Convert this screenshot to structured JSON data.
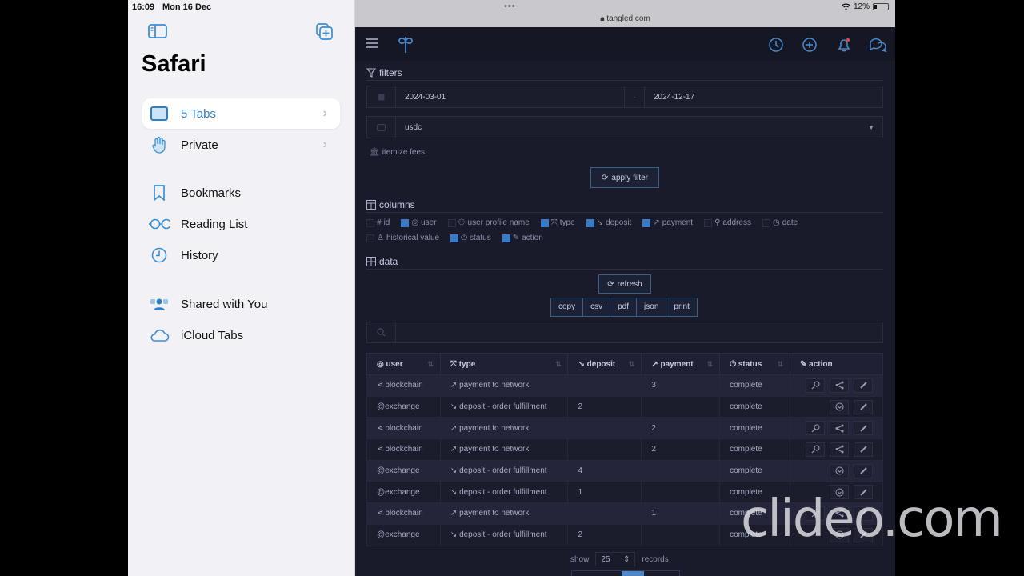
{
  "status_bar": {
    "time": "16:09",
    "date": "Mon 16 Dec",
    "battery": "12%"
  },
  "sidebar": {
    "title": "Safari",
    "items": [
      {
        "label": "5 Tabs",
        "icon": "tabs-icon",
        "active": true,
        "chevron": "›"
      },
      {
        "label": "Private",
        "icon": "hand-icon",
        "chevron": "›"
      },
      {
        "label": "Bookmarks",
        "icon": "bookmark-icon"
      },
      {
        "label": "Reading List",
        "icon": "glasses-icon"
      },
      {
        "label": "History",
        "icon": "clock-icon"
      },
      {
        "label": "Shared with You",
        "icon": "shared-icon"
      },
      {
        "label": "iCloud Tabs",
        "icon": "cloud-icon"
      }
    ]
  },
  "browser": {
    "dots": "•••",
    "url": "tangled.com"
  },
  "filters": {
    "heading": "filters",
    "date_from": "2024-03-01",
    "date_sep": "-",
    "date_to": "2024-12-17",
    "currency": "usdc",
    "itemize_label": "itemize fees",
    "apply_label": "apply filter"
  },
  "columns": {
    "heading": "columns",
    "options": [
      {
        "label": "id",
        "glyph": "#",
        "checked": false
      },
      {
        "label": "user",
        "glyph": "◎",
        "checked": true
      },
      {
        "label": "user profile name",
        "glyph": "⚇",
        "checked": false
      },
      {
        "label": "type",
        "glyph": "⤧",
        "checked": true
      },
      {
        "label": "deposit",
        "glyph": "↘",
        "checked": true
      },
      {
        "label": "payment",
        "glyph": "↗",
        "checked": true
      },
      {
        "label": "address",
        "glyph": "⚲",
        "checked": false
      },
      {
        "label": "date",
        "glyph": "◷",
        "checked": false
      },
      {
        "label": "historical value",
        "glyph": "♙",
        "checked": false
      },
      {
        "label": "status",
        "glyph": "⏻",
        "checked": true
      },
      {
        "label": "action",
        "glyph": "✎",
        "checked": true
      }
    ]
  },
  "data_section": {
    "heading": "data",
    "refresh_label": "refresh",
    "export": [
      "copy",
      "csv",
      "pdf",
      "json",
      "print"
    ],
    "search_placeholder": ""
  },
  "table": {
    "headers": [
      {
        "label": "user",
        "glyph": "◎"
      },
      {
        "label": "type",
        "glyph": "⤧"
      },
      {
        "label": "deposit",
        "glyph": "↘"
      },
      {
        "label": "payment",
        "glyph": "↗"
      },
      {
        "label": "status",
        "glyph": "⏻"
      },
      {
        "label": "action",
        "glyph": "✎"
      }
    ],
    "rows": [
      {
        "user": "blockchain",
        "user_icon": "share",
        "type": "↗ payment to network",
        "deposit": "",
        "payment": "3",
        "status": "complete",
        "actions": [
          "key",
          "share",
          "edit"
        ]
      },
      {
        "user": "@exchange",
        "user_icon": "",
        "type": "↘ deposit - order fulfillment",
        "deposit": "2",
        "payment": "",
        "status": "complete",
        "actions": [
          "download",
          "edit"
        ]
      },
      {
        "user": "blockchain",
        "user_icon": "share",
        "type": "↗ payment to network",
        "deposit": "",
        "payment": "2",
        "status": "complete",
        "actions": [
          "key",
          "share",
          "edit"
        ]
      },
      {
        "user": "blockchain",
        "user_icon": "share",
        "type": "↗ payment to network",
        "deposit": "",
        "payment": "2",
        "status": "complete",
        "actions": [
          "key",
          "share",
          "edit"
        ]
      },
      {
        "user": "@exchange",
        "user_icon": "",
        "type": "↘ deposit - order fulfillment",
        "deposit": "4",
        "payment": "",
        "status": "complete",
        "actions": [
          "download",
          "edit"
        ]
      },
      {
        "user": "@exchange",
        "user_icon": "",
        "type": "↘ deposit - order fulfillment",
        "deposit": "1",
        "payment": "",
        "status": "complete",
        "actions": [
          "download",
          "edit"
        ]
      },
      {
        "user": "blockchain",
        "user_icon": "share",
        "type": "↗ payment to network",
        "deposit": "",
        "payment": "1",
        "status": "complete",
        "actions": [
          "key",
          "share",
          "edit"
        ]
      },
      {
        "user": "@exchange",
        "user_icon": "",
        "type": "↘ deposit - order fulfillment",
        "deposit": "2",
        "payment": "",
        "status": "complete",
        "actions": [
          "download",
          "edit"
        ]
      }
    ]
  },
  "pager": {
    "show_label": "show",
    "page_size": "25",
    "records_label": "records"
  },
  "watermark": "clideo.com",
  "colors": {
    "accent": "#3a7bc8",
    "sidebar_active": "#2f7fc1",
    "notification_dot": "#e0443a"
  }
}
